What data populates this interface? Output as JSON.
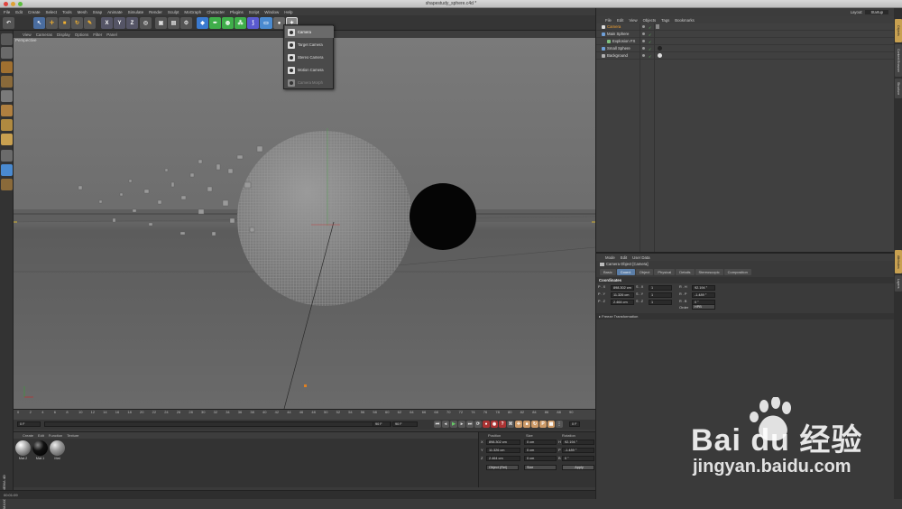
{
  "window": {
    "title": "shapestudy_sphere.c4d *"
  },
  "menubar": [
    "File",
    "Edit",
    "Create",
    "Select",
    "Tools",
    "Mesh",
    "Snap",
    "Animate",
    "Simulate",
    "Render",
    "Sculpt",
    "MoGraph",
    "Character",
    "Plugins",
    "Script",
    "Window",
    "Help"
  ],
  "viewport": {
    "menu": [
      "View",
      "Cameras",
      "Display",
      "Options",
      "Filter",
      "Panel"
    ],
    "label": "Perspective"
  },
  "camera_dropdown": {
    "items": [
      "Camera",
      "Target Camera",
      "Stereo Camera",
      "Motion Camera",
      "Camera Morph"
    ],
    "selected": "Camera"
  },
  "timeline": {
    "ticks": [
      "0",
      "2",
      "4",
      "6",
      "8",
      "10",
      "12",
      "14",
      "16",
      "18",
      "20",
      "22",
      "24",
      "26",
      "28",
      "30",
      "32",
      "34",
      "36",
      "38",
      "40",
      "42",
      "44",
      "46",
      "48",
      "50",
      "52",
      "54",
      "56",
      "58",
      "60",
      "62",
      "64",
      "66",
      "68",
      "70",
      "72",
      "74",
      "76",
      "78",
      "80",
      "82",
      "84",
      "86",
      "88",
      "90"
    ],
    "current_frame": "0 F",
    "end_frame_right": "0 F",
    "start_field": "0 F",
    "end_field": "90 F",
    "end_field2": "90 F"
  },
  "material_manager": {
    "menu": [
      "Create",
      "Edit",
      "Function",
      "Texture"
    ],
    "materials": [
      "Mat.2",
      "Mat.1",
      "Mat"
    ]
  },
  "coordinates": {
    "headers": [
      "Position",
      "Size",
      "Rotation"
    ],
    "rows": [
      {
        "axis": "X",
        "pos": "898.302 cm",
        "size": "0 cm",
        "rot_label": "H",
        "rot": "92.194 °"
      },
      {
        "axis": "Y",
        "pos": "11.326 cm",
        "size": "0 cm",
        "rot_label": "P",
        "rot": "-1.489 °"
      },
      {
        "axis": "Z",
        "pos": "2.464 cm",
        "size": "0 cm",
        "rot_label": "B",
        "rot": "0 °"
      }
    ],
    "mode": "Object (Rel)",
    "size_mode": "Size",
    "apply": "Apply"
  },
  "status": {
    "time": "00:01:09"
  },
  "right_header": {
    "layout_label": "Layout:",
    "layout_value": "Startup"
  },
  "object_manager": {
    "menu": [
      "File",
      "Edit",
      "View",
      "Objects",
      "Tags",
      "Bookmarks"
    ],
    "objects": [
      {
        "name": "Camera",
        "indent": 0,
        "highlight": true
      },
      {
        "name": "Main Sphere",
        "indent": 0,
        "highlight": false
      },
      {
        "name": "Explosion FX",
        "indent": 1,
        "highlight": false
      },
      {
        "name": "Small Sphere",
        "indent": 0,
        "highlight": false
      },
      {
        "name": "Background",
        "indent": 0,
        "highlight": false
      }
    ]
  },
  "attribute_manager": {
    "menu": [
      "Mode",
      "Edit",
      "User Data"
    ],
    "object_title": "Camera Object [Camera]",
    "tabs": [
      "Basic",
      "Coord.",
      "Object",
      "Physical",
      "Details",
      "Stereoscopic",
      "Composition"
    ],
    "active_tab": "Coord.",
    "section": "Coordinates",
    "rows": [
      {
        "p_label": "P . X",
        "p": "898.302 cm",
        "s_label": "S . X",
        "s": "1",
        "r_label": "R . H",
        "r": "92.194 °"
      },
      {
        "p_label": "P . Y",
        "p": "11.326 cm",
        "s_label": "S . Y",
        "s": "1",
        "r_label": "R . P",
        "r": "-1.489 °"
      },
      {
        "p_label": "P . Z",
        "p": "2.464 cm",
        "s_label": "S . Z",
        "s": "1",
        "r_label": "R . B",
        "r": "0 °"
      }
    ],
    "order_label": "Order",
    "order_value": "HPB",
    "freeze": "▸ Freeze Transformation"
  },
  "side_tabs": [
    "Objects",
    "Content Browser",
    "Structure",
    "Attributes",
    "Layers"
  ],
  "branding": {
    "logo": "MAXON CINEMA 4D"
  },
  "watermark": {
    "brand": "Bai du 经验",
    "url": "jingyan.baidu.com"
  },
  "colors": {
    "accent": "#5b7ea8",
    "highlight_text": "#f0a030",
    "viewport_bg": "#707070"
  }
}
